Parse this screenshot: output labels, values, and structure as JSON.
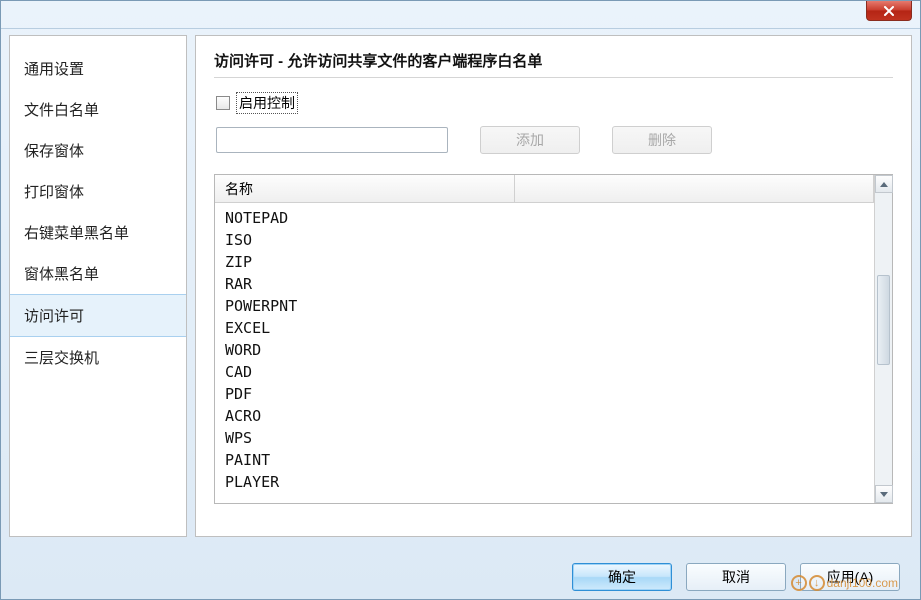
{
  "sidebar": {
    "items": [
      {
        "label": "通用设置"
      },
      {
        "label": "文件白名单"
      },
      {
        "label": "保存窗体"
      },
      {
        "label": "打印窗体"
      },
      {
        "label": "右键菜单黑名单"
      },
      {
        "label": "窗体黑名单"
      },
      {
        "label": "访问许可"
      },
      {
        "label": "三层交换机"
      }
    ],
    "selected_index": 6
  },
  "main": {
    "title": "访问许可 - 允许访问共享文件的客户端程序白名单",
    "enable_label": "启用控制",
    "enable_checked": false,
    "input_value": "",
    "add_label": "添加",
    "delete_label": "删除",
    "list": {
      "columns": [
        "名称",
        ""
      ],
      "rows": [
        "NOTEPAD",
        "ISO",
        "ZIP",
        "RAR",
        "POWERPNT",
        "EXCEL",
        "WORD",
        "CAD",
        "PDF",
        "ACRO",
        "WPS",
        "PAINT",
        "PLAYER"
      ]
    }
  },
  "buttons": {
    "ok": "确定",
    "cancel": "取消",
    "apply": "应用(A)"
  },
  "watermark": "danji100.com"
}
